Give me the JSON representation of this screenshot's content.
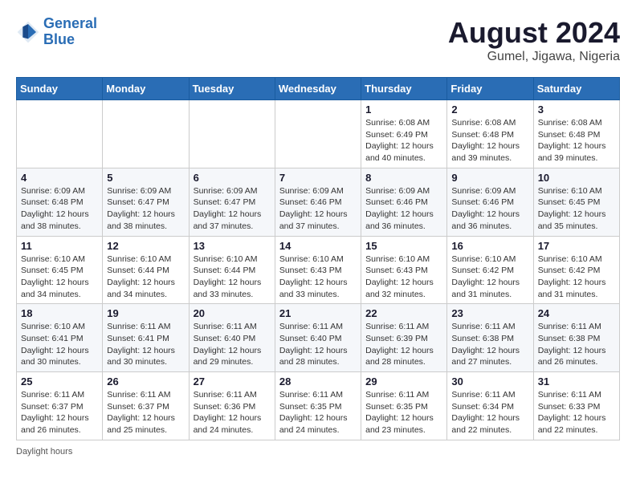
{
  "header": {
    "logo_line1": "General",
    "logo_line2": "Blue",
    "month_year": "August 2024",
    "location": "Gumel, Jigawa, Nigeria"
  },
  "days_of_week": [
    "Sunday",
    "Monday",
    "Tuesday",
    "Wednesday",
    "Thursday",
    "Friday",
    "Saturday"
  ],
  "footer": "Daylight hours",
  "weeks": [
    [
      {
        "day": "",
        "info": ""
      },
      {
        "day": "",
        "info": ""
      },
      {
        "day": "",
        "info": ""
      },
      {
        "day": "",
        "info": ""
      },
      {
        "day": "1",
        "info": "Sunrise: 6:08 AM\nSunset: 6:49 PM\nDaylight: 12 hours and 40 minutes."
      },
      {
        "day": "2",
        "info": "Sunrise: 6:08 AM\nSunset: 6:48 PM\nDaylight: 12 hours and 39 minutes."
      },
      {
        "day": "3",
        "info": "Sunrise: 6:08 AM\nSunset: 6:48 PM\nDaylight: 12 hours and 39 minutes."
      }
    ],
    [
      {
        "day": "4",
        "info": "Sunrise: 6:09 AM\nSunset: 6:48 PM\nDaylight: 12 hours and 38 minutes."
      },
      {
        "day": "5",
        "info": "Sunrise: 6:09 AM\nSunset: 6:47 PM\nDaylight: 12 hours and 38 minutes."
      },
      {
        "day": "6",
        "info": "Sunrise: 6:09 AM\nSunset: 6:47 PM\nDaylight: 12 hours and 37 minutes."
      },
      {
        "day": "7",
        "info": "Sunrise: 6:09 AM\nSunset: 6:46 PM\nDaylight: 12 hours and 37 minutes."
      },
      {
        "day": "8",
        "info": "Sunrise: 6:09 AM\nSunset: 6:46 PM\nDaylight: 12 hours and 36 minutes."
      },
      {
        "day": "9",
        "info": "Sunrise: 6:09 AM\nSunset: 6:46 PM\nDaylight: 12 hours and 36 minutes."
      },
      {
        "day": "10",
        "info": "Sunrise: 6:10 AM\nSunset: 6:45 PM\nDaylight: 12 hours and 35 minutes."
      }
    ],
    [
      {
        "day": "11",
        "info": "Sunrise: 6:10 AM\nSunset: 6:45 PM\nDaylight: 12 hours and 34 minutes."
      },
      {
        "day": "12",
        "info": "Sunrise: 6:10 AM\nSunset: 6:44 PM\nDaylight: 12 hours and 34 minutes."
      },
      {
        "day": "13",
        "info": "Sunrise: 6:10 AM\nSunset: 6:44 PM\nDaylight: 12 hours and 33 minutes."
      },
      {
        "day": "14",
        "info": "Sunrise: 6:10 AM\nSunset: 6:43 PM\nDaylight: 12 hours and 33 minutes."
      },
      {
        "day": "15",
        "info": "Sunrise: 6:10 AM\nSunset: 6:43 PM\nDaylight: 12 hours and 32 minutes."
      },
      {
        "day": "16",
        "info": "Sunrise: 6:10 AM\nSunset: 6:42 PM\nDaylight: 12 hours and 31 minutes."
      },
      {
        "day": "17",
        "info": "Sunrise: 6:10 AM\nSunset: 6:42 PM\nDaylight: 12 hours and 31 minutes."
      }
    ],
    [
      {
        "day": "18",
        "info": "Sunrise: 6:10 AM\nSunset: 6:41 PM\nDaylight: 12 hours and 30 minutes."
      },
      {
        "day": "19",
        "info": "Sunrise: 6:11 AM\nSunset: 6:41 PM\nDaylight: 12 hours and 30 minutes."
      },
      {
        "day": "20",
        "info": "Sunrise: 6:11 AM\nSunset: 6:40 PM\nDaylight: 12 hours and 29 minutes."
      },
      {
        "day": "21",
        "info": "Sunrise: 6:11 AM\nSunset: 6:40 PM\nDaylight: 12 hours and 28 minutes."
      },
      {
        "day": "22",
        "info": "Sunrise: 6:11 AM\nSunset: 6:39 PM\nDaylight: 12 hours and 28 minutes."
      },
      {
        "day": "23",
        "info": "Sunrise: 6:11 AM\nSunset: 6:38 PM\nDaylight: 12 hours and 27 minutes."
      },
      {
        "day": "24",
        "info": "Sunrise: 6:11 AM\nSunset: 6:38 PM\nDaylight: 12 hours and 26 minutes."
      }
    ],
    [
      {
        "day": "25",
        "info": "Sunrise: 6:11 AM\nSunset: 6:37 PM\nDaylight: 12 hours and 26 minutes."
      },
      {
        "day": "26",
        "info": "Sunrise: 6:11 AM\nSunset: 6:37 PM\nDaylight: 12 hours and 25 minutes."
      },
      {
        "day": "27",
        "info": "Sunrise: 6:11 AM\nSunset: 6:36 PM\nDaylight: 12 hours and 24 minutes."
      },
      {
        "day": "28",
        "info": "Sunrise: 6:11 AM\nSunset: 6:35 PM\nDaylight: 12 hours and 24 minutes."
      },
      {
        "day": "29",
        "info": "Sunrise: 6:11 AM\nSunset: 6:35 PM\nDaylight: 12 hours and 23 minutes."
      },
      {
        "day": "30",
        "info": "Sunrise: 6:11 AM\nSunset: 6:34 PM\nDaylight: 12 hours and 22 minutes."
      },
      {
        "day": "31",
        "info": "Sunrise: 6:11 AM\nSunset: 6:33 PM\nDaylight: 12 hours and 22 minutes."
      }
    ]
  ]
}
